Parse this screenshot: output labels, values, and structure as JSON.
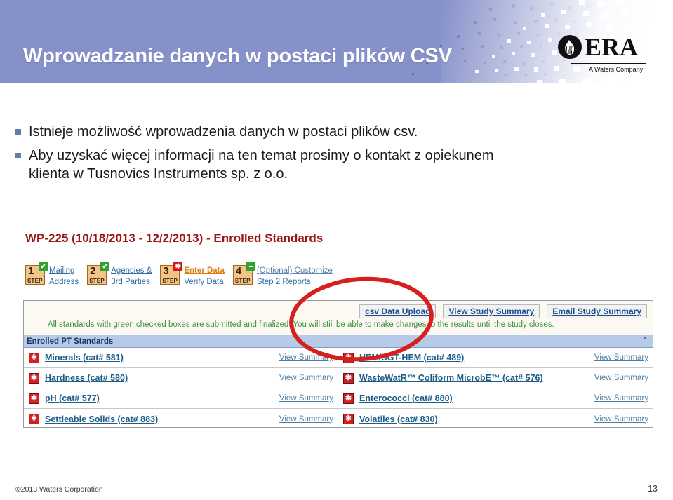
{
  "slide": {
    "title": "Wprowadzanie danych w postaci plików CSV",
    "bullets": [
      "Istnieje możliwość wprowadzenia danych w postaci plików csv.",
      "Aby uzyskać więcej informacji na ten temat prosimy o kontakt z opiekunem klienta w Tusnovics Instruments sp. z o.o."
    ]
  },
  "logo": {
    "wordmark": "ERA",
    "tagline": "A Waters Company"
  },
  "screenshot": {
    "study_title": "WP-225 (10/18/2013 - 12/2/2013) - Enrolled Standards",
    "steps": [
      {
        "number": "1",
        "word": "STEP",
        "badge": "✔",
        "badge_kind": "check",
        "line1": "Mailing",
        "line2": "Address",
        "state": "normal"
      },
      {
        "number": "2",
        "word": "STEP",
        "badge": "✔",
        "badge_kind": "check",
        "line1": "Agencies &",
        "line2": "3rd Parties",
        "state": "normal"
      },
      {
        "number": "3",
        "word": "STEP",
        "badge": "✱",
        "badge_kind": "star",
        "line1": "Enter Data",
        "line2": "Verify Data",
        "state": "active"
      },
      {
        "number": "4",
        "word": "STEP",
        "badge": "–",
        "badge_kind": "dash",
        "line1": "(Optional) Customize",
        "line2": "Step 2 Reports",
        "state": "muted"
      }
    ],
    "action_buttons": [
      "csv Data Upload",
      "View Study Summary",
      "Email Study Summary"
    ],
    "note": "All standards with green checked boxes are submitted and finalized. You will still be able to make changes to the results until the study closes.",
    "panel_bar_title": "Enrolled PT Standards",
    "collapse_glyph": "⌃",
    "summary_link": "View Summary",
    "check_glyph": "✱",
    "standards_left": [
      "Minerals (cat# 581)",
      "Hardness (cat# 580)",
      "pH (cat# 577)",
      "Settleable Solids (cat# 883)"
    ],
    "standards_right": [
      "HEM/SGT-HEM (cat# 489)",
      "WasteWatR™ Coliform MicrobE™ (cat# 576)",
      "Enterococci (cat# 880)",
      "Volatiles (cat# 830)"
    ]
  },
  "footer": {
    "copyright": "©2013 Waters Corporation",
    "page_number": "13"
  },
  "colors": {
    "header_blue": "#8690c9",
    "title_red": "#9c1616",
    "annotation_red": "#d61f1f",
    "link_blue": "#1d5c86",
    "active_orange": "#e07b10",
    "note_green": "#3f8f3f",
    "panel_bar_blue": "#b7cbe8"
  }
}
